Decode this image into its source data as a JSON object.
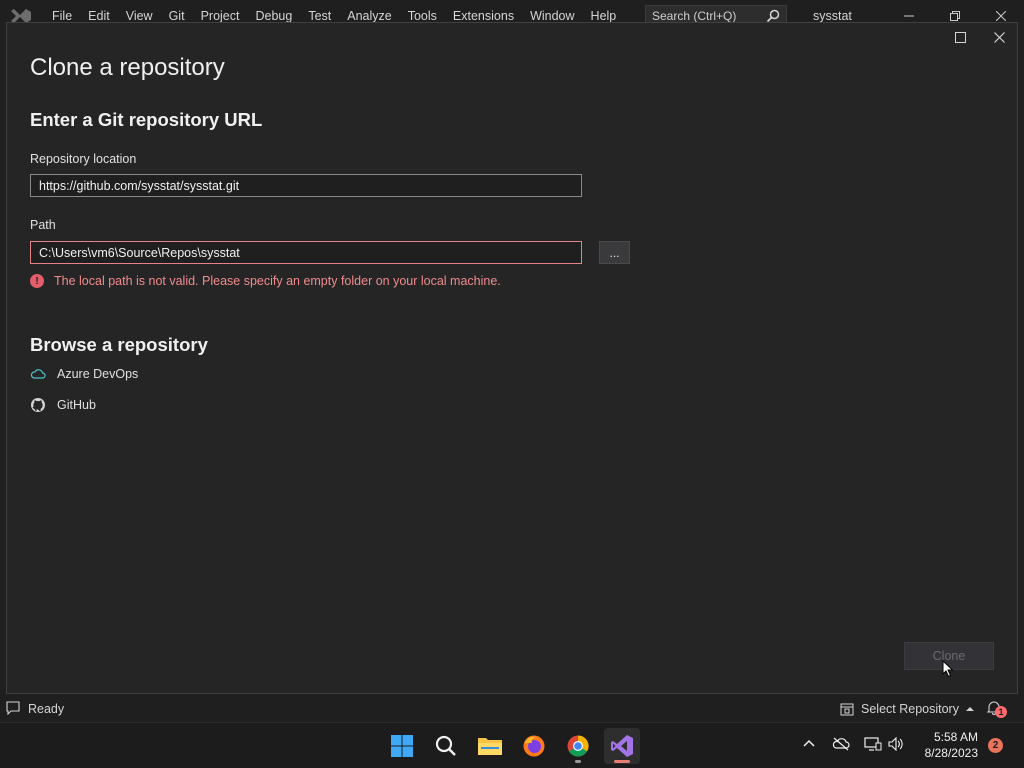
{
  "menubar": {
    "items": [
      "File",
      "Edit",
      "View",
      "Git",
      "Project",
      "Debug",
      "Test",
      "Analyze",
      "Tools",
      "Extensions",
      "Window",
      "Help"
    ],
    "search_placeholder": "Search (Ctrl+Q)",
    "solution_name": "sysstat"
  },
  "dialog": {
    "title": "Clone a repository",
    "url_section_title": "Enter a Git repository URL",
    "repo_location_label": "Repository location",
    "repo_location_value": "https://github.com/sysstat/sysstat.git",
    "path_label": "Path",
    "path_value": "C:\\Users\\vm6\\Source\\Repos\\sysstat",
    "browse_button_label": "...",
    "error_message": "The local path is not valid. Please specify an empty folder on your local machine.",
    "browse_section_title": "Browse a repository",
    "browse_items": [
      {
        "label": "Azure DevOps",
        "icon": "cloud-icon"
      },
      {
        "label": "GitHub",
        "icon": "github-icon"
      }
    ],
    "clone_button_label": "Clone"
  },
  "statusbar": {
    "status_text": "Ready",
    "select_repo_label": "Select Repository",
    "notification_count": "1"
  },
  "taskbar": {
    "apps": [
      "windows-start",
      "search",
      "file-explorer",
      "firefox",
      "chrome",
      "visual-studio"
    ],
    "time": "5:58 AM",
    "date": "8/28/2023",
    "notification_badge": "2"
  },
  "colors": {
    "accent_error": "#e3838a",
    "background": "#1f1f1f",
    "dialog_bg": "#252526"
  }
}
